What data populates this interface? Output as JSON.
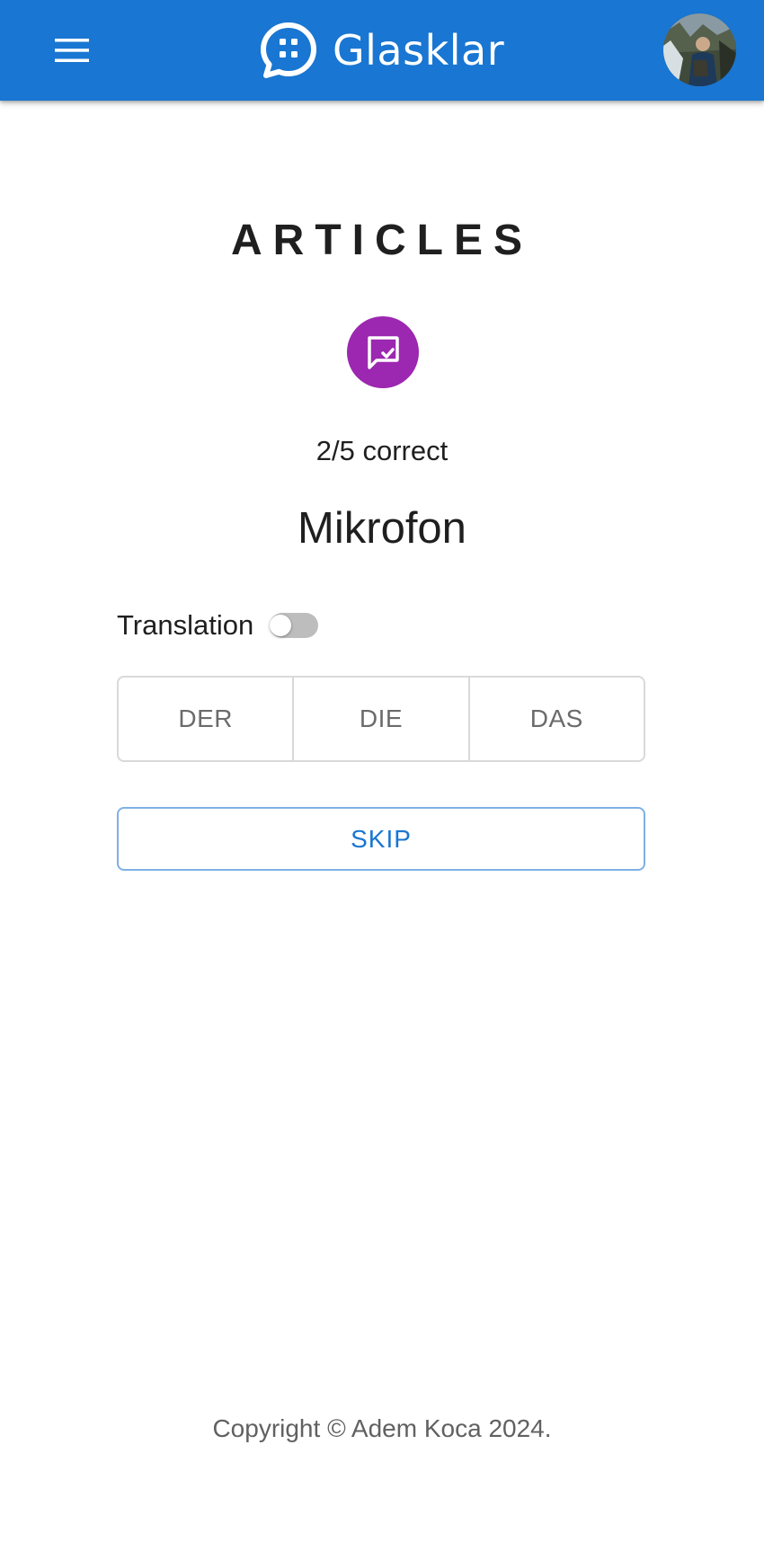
{
  "header": {
    "brand_name": "Glasklar",
    "menu_icon": "hamburger-menu-icon",
    "logo_icon": "chat-bubble-logo-icon",
    "avatar": "user-avatar-photo"
  },
  "colors": {
    "app_bar": "#1976d2",
    "badge": "#9c27b0",
    "skip_text": "#1976d2",
    "skip_border": "#7fb0e6"
  },
  "main": {
    "title": "ARTICLES",
    "badge_icon": "rate-review-icon",
    "score_text": "2/5 correct",
    "word": "Mikrofon",
    "translation_label": "Translation",
    "translation_enabled": false,
    "articles": [
      "DER",
      "DIE",
      "DAS"
    ],
    "skip_label": "SKIP"
  },
  "footer": {
    "copyright": "Copyright © Adem Koca 2024."
  }
}
